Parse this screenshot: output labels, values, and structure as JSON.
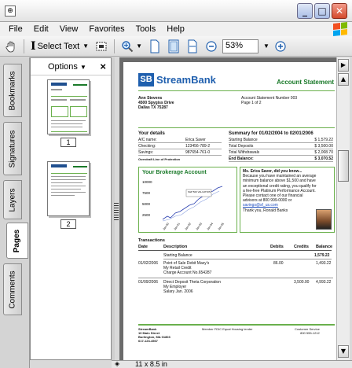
{
  "window": {
    "icon": "acrobat-app-icon",
    "minimize": "_",
    "maximize": "□",
    "close": "✕"
  },
  "menu": [
    "File",
    "Edit",
    "View",
    "Favorites",
    "Tools",
    "Help"
  ],
  "toolbar": {
    "select_text": "Select Text",
    "zoom": "53%"
  },
  "left_tabs": [
    "Bookmarks",
    "Signatures",
    "Layers",
    "Pages",
    "Comments"
  ],
  "panel": {
    "title": "Options",
    "close": "×",
    "pages": [
      "1",
      "2"
    ]
  },
  "document": {
    "logo_mark": "SB",
    "logo_name": "StreamBank",
    "title": "Account Statement",
    "address": [
      "Ann Stevens",
      "4500 Spygiss Drive",
      "Dallas TX 75287"
    ],
    "statement_number": "Account Statement Number  003",
    "page_info": "Page 1 of 2",
    "details_title": "Your details",
    "details": [
      {
        "label": "A/C name:",
        "value": "Erica Saver"
      },
      {
        "label": "Checking:",
        "value": "123456-789-2"
      },
      {
        "label": "Savings:",
        "value": "987654-761-0"
      }
    ],
    "overdraft": "Overdraft Line of Protection",
    "summary_title": "Summary for 01/02/2004 to 02/01/2006",
    "summary": [
      {
        "label": "Starting Balance",
        "value": "$ 1,579.22"
      },
      {
        "label": "Total Deposits",
        "value": "$ 3,500.00"
      },
      {
        "label": "Total Withdrawals",
        "value": "$ 2,008.70"
      },
      {
        "label": "End Balance:",
        "value": "$ 3,070.52"
      }
    ],
    "brokerage": {
      "title": "Your Brokerage Account",
      "yticks": [
        "10000",
        "7500",
        "5000",
        "2500"
      ],
      "xticks": [
        "Jan-00",
        "Jan-01",
        "Jan-02",
        "Jan-03",
        "Jan-04",
        "Jan-05"
      ],
      "legend": "S&P 500 VALUATION"
    },
    "promo": {
      "head": "Ms. Erica Saver, did you know...",
      "body": "Because you have maintained an average minimum balance above $1,500 and have an exceptional credit rating, you qualify for a fee-free Platinum Performance Account. Please contact one of our financial advisors at 800 999-0000 or",
      "link": "savings@sf_us.com",
      "thanks": "Thank you, Ronald Banks"
    },
    "transactions_title": "Transactions",
    "tx_headers": [
      "Date",
      "Description",
      "Debits",
      "Credits",
      "Balance"
    ],
    "transactions": [
      {
        "date": "",
        "desc": [
          "Starting Balance"
        ],
        "debit": "",
        "credit": "",
        "balance": "1,579.22"
      },
      {
        "date": "01/02/2006",
        "desc": [
          "Point of Sale Debit Maxy's",
          "My Retail Credit",
          "Charge Account No.654287"
        ],
        "debit": "86.00",
        "credit": "",
        "balance": "1,493.22"
      },
      {
        "date": "01/09/2006",
        "desc": [
          "Direct Deposit Theta Corporation",
          "My Employer",
          "Salary  Jan. 2006"
        ],
        "debit": "",
        "credit": "3,500.00",
        "balance": "4,993.22"
      }
    ],
    "footer_bank": [
      "StreamBank",
      "10 Main Street",
      "Burlington, MA 01803",
      "617-123-4567"
    ],
    "footer_member": "Member FDIC  Equal Housing lender",
    "footer_service": [
      "Customer Service",
      "800 555-1212"
    ]
  },
  "status": {
    "page_size": "11 x 8.5 in"
  }
}
